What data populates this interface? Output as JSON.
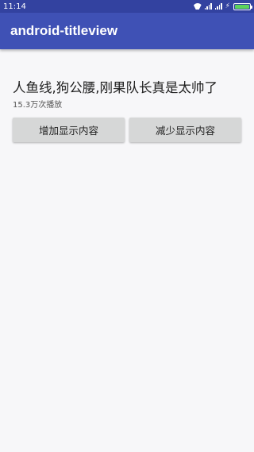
{
  "status_bar": {
    "time": "11:14",
    "battery_color": "#5cd35c"
  },
  "app_bar": {
    "title": "android-titleview",
    "color": "#3f51b5"
  },
  "main": {
    "title": "人鱼线,狗公腰,刚果队长真是太帅了",
    "play_count": "15.3万次播放",
    "buttons": {
      "increase_label": "增加显示内容",
      "decrease_label": "减少显示内容"
    }
  }
}
